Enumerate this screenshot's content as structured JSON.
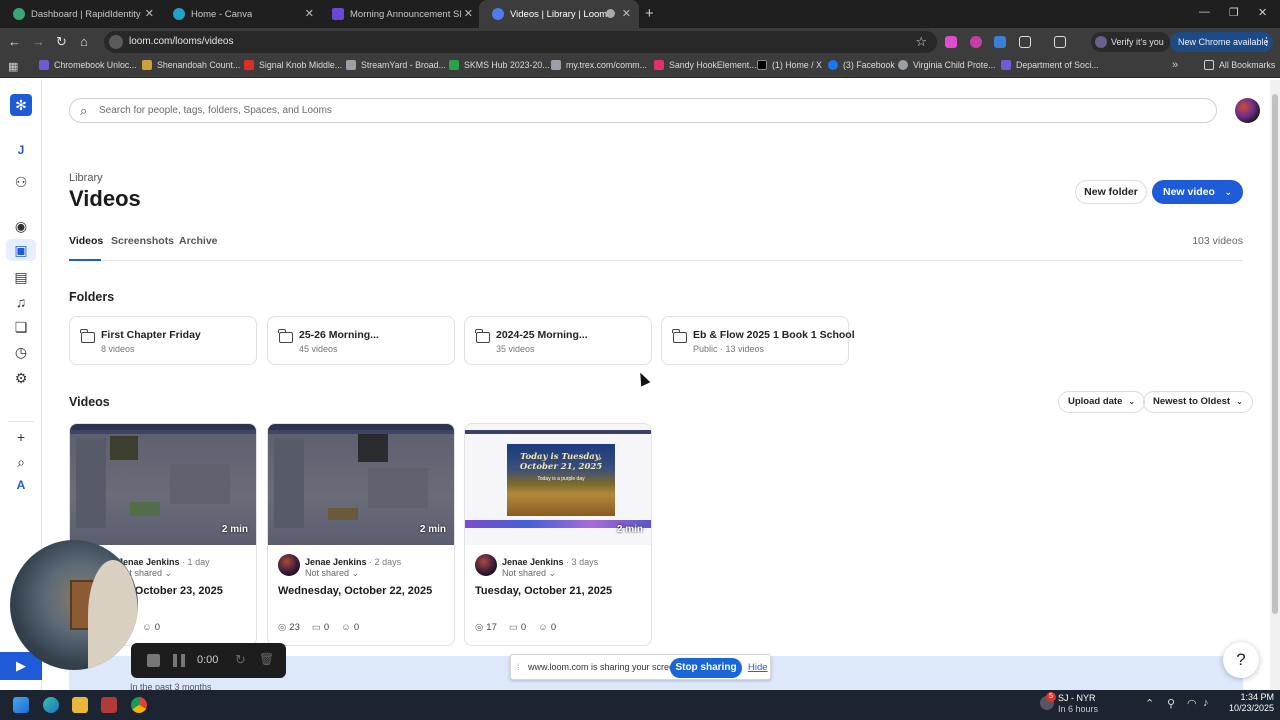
{
  "browser": {
    "tabs": [
      {
        "title": "Dashboard | RapidIdentity",
        "active": false,
        "color": "#3aa675"
      },
      {
        "title": "Home - Canva",
        "active": false,
        "color": "#1fa3c9"
      },
      {
        "title": "Morning Announcement Slide",
        "active": false,
        "color": "#6b47d6"
      },
      {
        "title": "Videos | Library | Loom",
        "active": true,
        "color": "#4f7bef"
      }
    ],
    "new_tab": "+",
    "url": "loom.com/looms/videos",
    "verify_label": "Verify it's you",
    "new_chrome_label": "New Chrome available",
    "bookmarks": [
      {
        "label": "Chromebook Unloc...",
        "color": "#6f5bd6"
      },
      {
        "label": "Shenandoah Count...",
        "color": "#c9a23a"
      },
      {
        "label": "Signal Knob Middle...",
        "color": "#d93025"
      },
      {
        "label": "StreamYard - Broad...",
        "color": "#9aa0a6"
      },
      {
        "label": "SKMS Hub 2023-20...",
        "color": "#2da04a"
      },
      {
        "label": "my.trex.com/comm...",
        "color": "#9aa0a6"
      },
      {
        "label": "Sandy HookElement...",
        "color": "#e1306c"
      },
      {
        "label": "(1) Home / X",
        "color": "#000000"
      },
      {
        "label": "(3) Facebook",
        "color": "#1877f2"
      },
      {
        "label": "Virginia Child Prote...",
        "color": "#9aa0a6"
      },
      {
        "label": "Department of Soci...",
        "color": "#6f5bd6"
      }
    ],
    "all_bookmarks": "All Bookmarks"
  },
  "rail": {
    "workspace_initial": "J",
    "bottom_initial": "A"
  },
  "search": {
    "placeholder": "Search for people, tags, folders, Spaces, and Looms"
  },
  "header": {
    "breadcrumb": "Library",
    "title": "Videos",
    "new_folder": "New folder",
    "new_video": "New video"
  },
  "tabs": {
    "items": [
      "Videos",
      "Screenshots",
      "Archive"
    ],
    "count": "103 videos"
  },
  "folders": {
    "heading": "Folders",
    "items": [
      {
        "name": "First Chapter Friday",
        "sub": "8 videos"
      },
      {
        "name": "25-26 Morning...",
        "sub": "45 videos"
      },
      {
        "name": "2024-25 Morning...",
        "sub": "35 videos"
      },
      {
        "name": "Eb & Flow 2025 1 Book 1 School",
        "sub": "Public · 13 videos"
      }
    ]
  },
  "videos": {
    "heading": "Videos",
    "sort_field": "Upload date",
    "sort_order": "Newest to Oldest",
    "items": [
      {
        "duration": "2 min",
        "author": "Jenae Jenkins",
        "ago": "· 1 day",
        "share": "Not shared",
        "title": "Thursday, October 23, 2025",
        "views": "",
        "comments": "",
        "reactions": "0"
      },
      {
        "duration": "2 min",
        "author": "Jenae Jenkins",
        "ago": "· 2 days",
        "share": "Not shared",
        "title": "Wednesday, October 22, 2025",
        "views": "23",
        "comments": "0",
        "reactions": "0"
      },
      {
        "duration": "2 min",
        "author": "Jenae Jenkins",
        "ago": "· 3 days",
        "share": "Not shared",
        "title": "Tuesday, October 21, 2025",
        "views": "17",
        "comments": "0",
        "reactions": "0"
      }
    ],
    "slide_text": "Today is Tuesday, October 21, 2025",
    "slide_sub": "Today is a purple day",
    "past_label": "In the past 3 months"
  },
  "recorder": {
    "time": "0:00"
  },
  "sharing": {
    "message": "www.loom.com is sharing your screen.",
    "stop": "Stop sharing",
    "hide": "Hide"
  },
  "help": "?",
  "taskbar": {
    "weather_title": "SJ - NYR",
    "weather_sub": "In 6 hours",
    "weather_badge": "5",
    "time": "1:34 PM",
    "date": "10/23/2025"
  },
  "colors": {
    "accent": "#1e5bd8",
    "share_blue": "#1a66d9"
  }
}
